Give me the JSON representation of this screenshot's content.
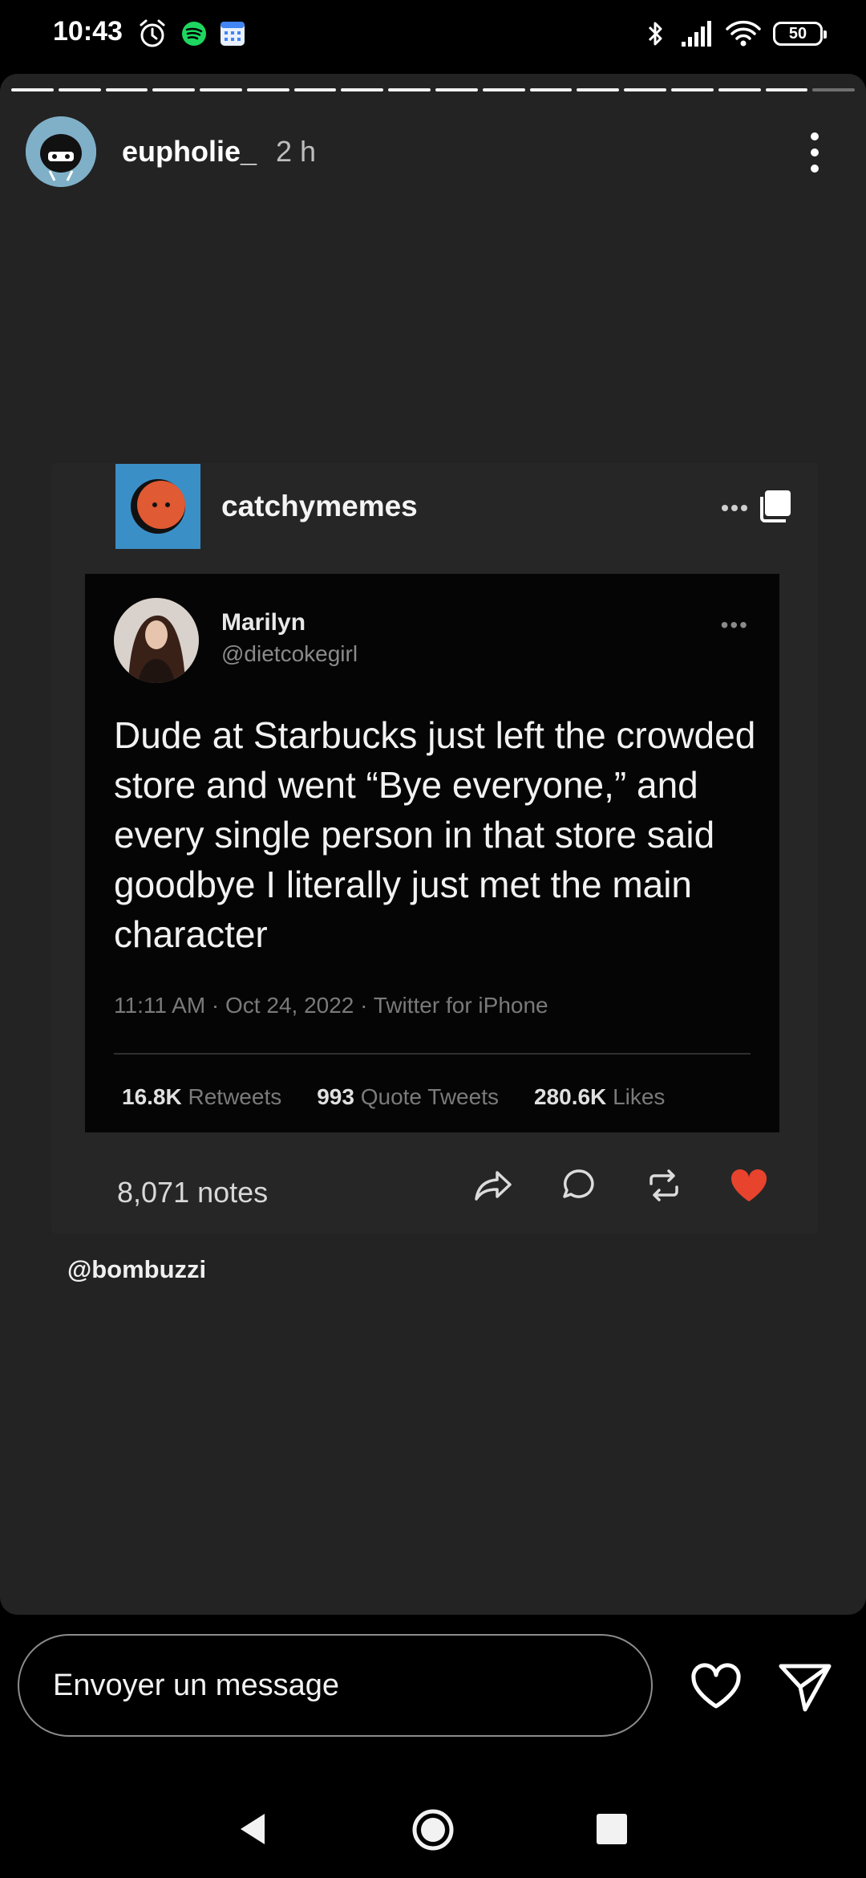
{
  "status_bar": {
    "time": "10:43",
    "left_icons": [
      "alarm-icon",
      "spotify-icon",
      "calendar-icon"
    ],
    "right_icons": [
      "bluetooth-icon",
      "cellular-signal-icon",
      "wifi-icon"
    ],
    "battery_level": "50"
  },
  "story": {
    "progress_total": 18,
    "progress_completed": 17,
    "username": "eupholie_",
    "time_ago": "2 h",
    "mention": "@bombuzzi"
  },
  "post": {
    "blog_name": "catchymemes",
    "notes": "8,071 notes",
    "liked": true,
    "like_color": "#e8432d",
    "tweet": {
      "name": "Marilyn",
      "handle": "@dietcokegirl",
      "text": "Dude at Starbucks just left the crowded store and went “Bye everyone,” and every single person in that store said goodbye I literally just met the main character",
      "meta": "11:11 AM · Oct 24, 2022 · Twitter for iPhone",
      "retweets_count": "16.8K",
      "retweets_label": "Retweets",
      "quotes_count": "993",
      "quotes_label": "Quote Tweets",
      "likes_count": "280.6K",
      "likes_label": "Likes"
    }
  },
  "reply": {
    "placeholder": "Envoyer un message"
  },
  "colors": {
    "story_background": "#232323",
    "blog_avatar": "#3b8fc7"
  }
}
